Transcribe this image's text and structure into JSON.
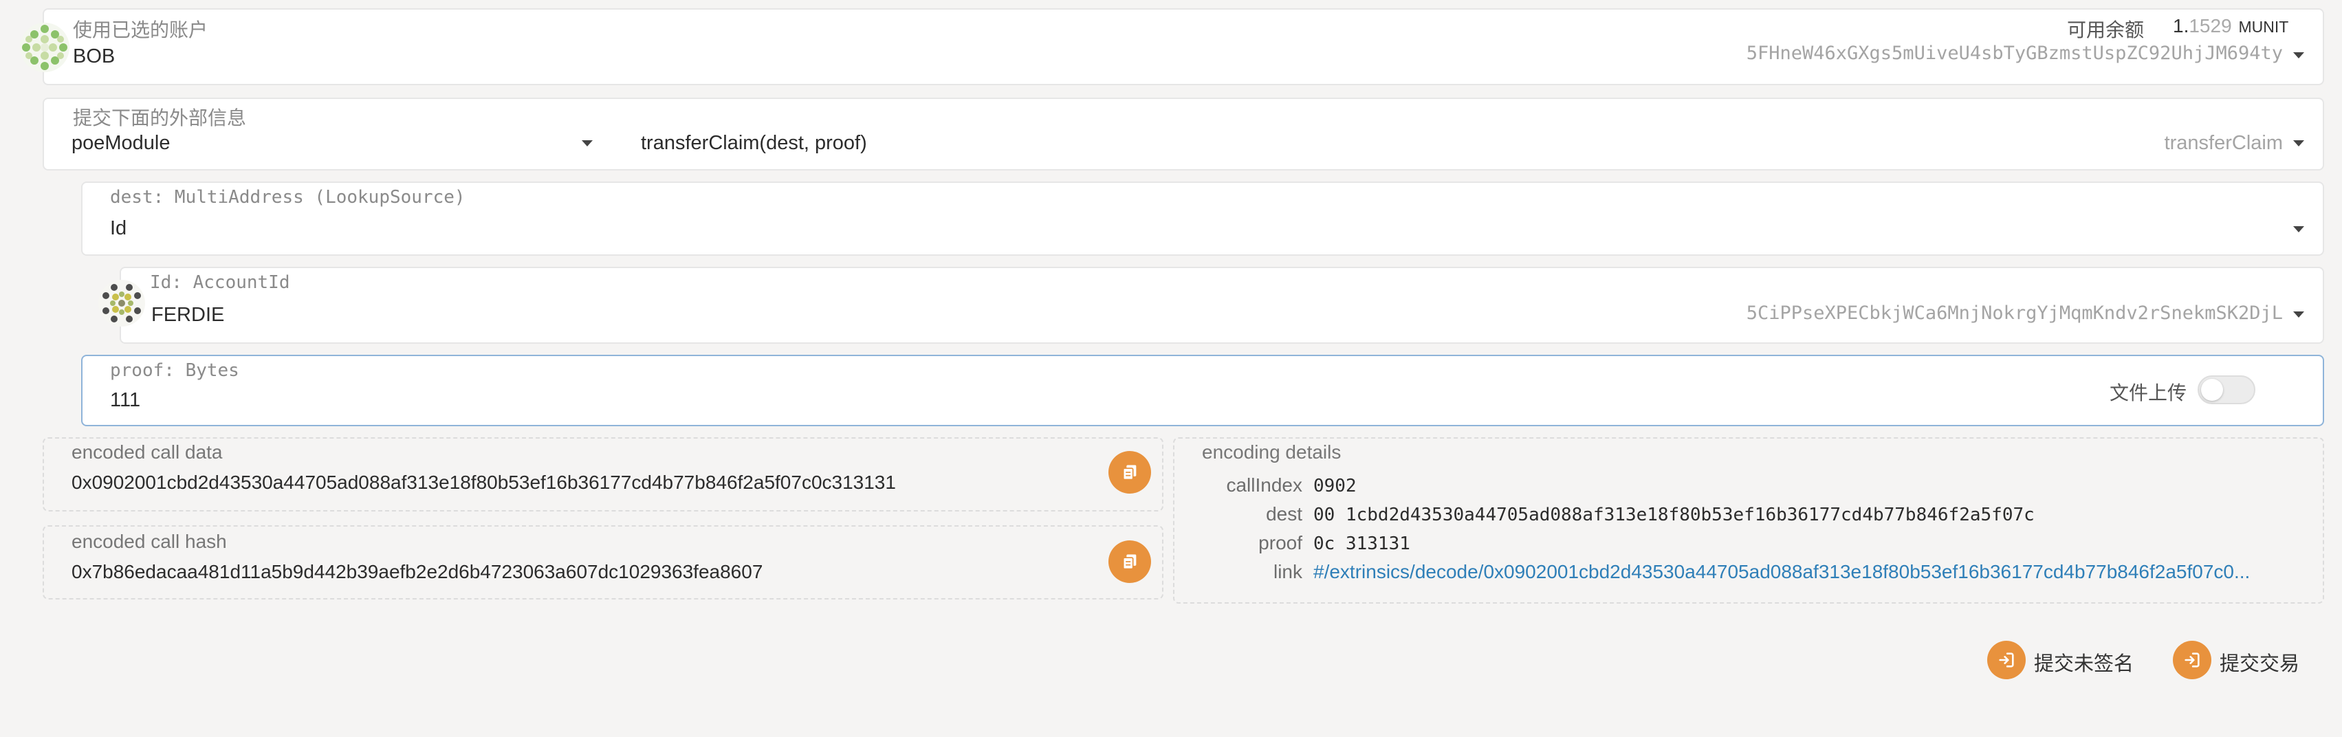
{
  "sender": {
    "label": "使用已选的账户",
    "name": "BOB",
    "address": "5FHneW46xGXgs5mUiveU4sbTyGBzmstUspZC92UhjJM694ty",
    "balance_label": "可用余额",
    "balance_int": "1.",
    "balance_dec": "1529",
    "balance_unit": "MUNIT"
  },
  "extrinsic": {
    "label": "提交下面的外部信息",
    "module": "poeModule",
    "call": "transferClaim(dest, proof)",
    "call_short": "transferClaim"
  },
  "dest": {
    "label": "dest: MultiAddress (LookupSource)",
    "value": "Id"
  },
  "dest_id": {
    "label": "Id: AccountId",
    "name": "FERDIE",
    "address": "5CiPPseXPECbkjWCa6MnjNokrgYjMqmKndv2rSnekmSK2DjL"
  },
  "proof": {
    "label": "proof: Bytes",
    "value": "111",
    "upload_label": "文件上传",
    "upload_enabled": false
  },
  "encoded_call_data": {
    "label": "encoded call data",
    "value": "0x0902001cbd2d43530a44705ad088af313e18f80b53ef16b36177cd4b77b846f2a5f07c0c313131"
  },
  "encoded_call_hash": {
    "label": "encoded call hash",
    "value": "0x7b86edacaa481d11a5b9d442b39aefb2e2d6b4723063a607dc1029363fea8607"
  },
  "encoding_details": {
    "label": "encoding details",
    "rows": [
      {
        "key": "callIndex",
        "value": "0902"
      },
      {
        "key": "dest",
        "value": "00 1cbd2d43530a44705ad088af313e18f80b53ef16b36177cd4b77b846f2a5f07c"
      },
      {
        "key": "proof",
        "value": "0c 313131"
      },
      {
        "key": "link",
        "value": "#/extrinsics/decode/0x0902001cbd2d43530a44705ad088af313e18f80b53ef16b36177cd4b77b846f2a5f07c0..."
      }
    ]
  },
  "actions": {
    "unsigned": "提交未签名",
    "sign": "提交交易"
  },
  "colors": {
    "accent": "#e8923d",
    "link": "#2f7fb8",
    "background": "#f5f4f3"
  },
  "icons": {
    "sender_avatar": "identicon",
    "dest_avatar": "identicon",
    "copy": "copy-icon",
    "submit": "sign-in-icon"
  }
}
